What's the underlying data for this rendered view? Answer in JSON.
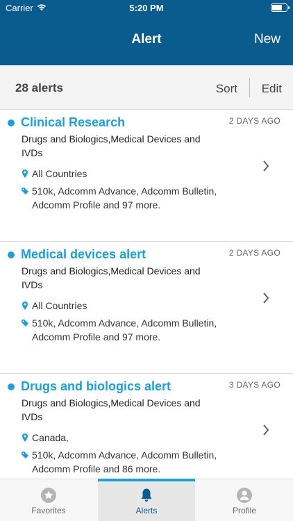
{
  "status": {
    "carrier": "Carrier",
    "time": "5:20 PM"
  },
  "nav": {
    "title": "Alert",
    "new_label": "New"
  },
  "toolbar": {
    "count": "28 alerts",
    "sort_label": "Sort",
    "edit_label": "Edit"
  },
  "alerts": [
    {
      "title": "Clinical Research",
      "date": "2 DAYS AGO",
      "products": "Drugs and Biologics,Medical Devices and IVDs",
      "location": "All Countries",
      "tags": "510k, Adcomm Advance, Adcomm Bulletin, Adcomm Profile and 97 more."
    },
    {
      "title": "Medical devices alert",
      "date": "2 DAYS AGO",
      "products": "Drugs and Biologics,Medical Devices and IVDs",
      "location": "All Countries",
      "tags": "510k, Adcomm Advance, Adcomm Bulletin, Adcomm Profile and 97 more."
    },
    {
      "title": "Drugs and biologics alert",
      "date": "3 DAYS AGO",
      "products": "Drugs and Biologics,Medical Devices and IVDs",
      "location": "Canada,",
      "tags": "510k, Adcomm Advance, Adcomm Bulletin, Adcomm Profile and 86 more."
    }
  ],
  "tabs": [
    {
      "label": "Favorites",
      "icon": "star-icon"
    },
    {
      "label": "Alerts",
      "icon": "bell-icon"
    },
    {
      "label": "Profile",
      "icon": "person-icon"
    }
  ],
  "colors": {
    "header": "#0a5c8e",
    "accent": "#1e9fd6"
  }
}
